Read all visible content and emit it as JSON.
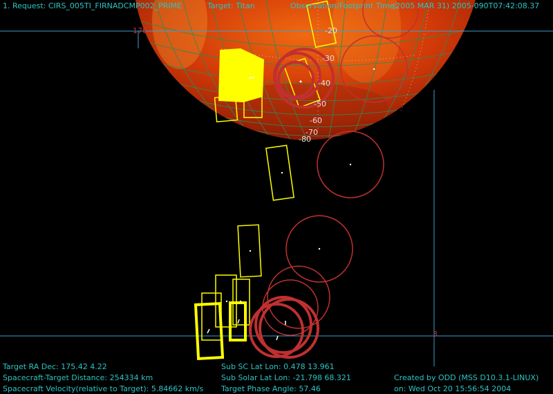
{
  "header": {
    "request": "1. Request:  CIRS_005TI_FIRNADCMP002_PRIME",
    "target": "Target: Titan",
    "obs_time_label": "Observation/Footprint Time:",
    "obs_time_value": "(2005 MAR 31)  2005-090T07:42:08.37"
  },
  "latitude_labels": [
    "-20",
    "-30",
    "-40",
    "-50",
    "-60",
    "-70",
    "-80"
  ],
  "axis_labels": {
    "top_left": "170",
    "right": "3"
  },
  "footer": {
    "target_ra_dec": "Target RA  Dec:  175.42    4.22",
    "sc_target_distance": "Spacecraft-Target Distance:   254334 km",
    "sc_velocity": "Spacecraft Velocity(relative to Target):  5.84662 km/s",
    "sub_sc": "Sub SC Lat Lon:  0.478   13.961",
    "sub_solar": "Sub Solar Lat Lon:  -21.798   68.321",
    "phase_angle": "Target Phase Angle:  57.46",
    "created_by": "Created by ODD (MSS D10.3.1-LINUX)",
    "created_on": "on: Wed Oct 20 15:56:54 2004"
  },
  "colors": {
    "text": "#2ec4c4",
    "footprint_yellow": "#ffff00",
    "footprint_red": "#c03030",
    "grid_green": "#2e8b57",
    "frame_blue": "#3aa0d0"
  }
}
